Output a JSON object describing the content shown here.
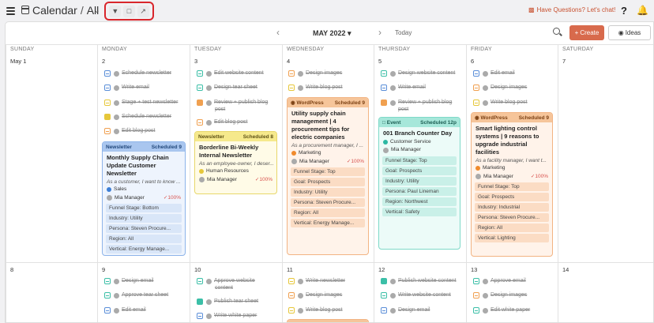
{
  "header": {
    "title": "Calendar",
    "view": "All",
    "help_text": "Have Questions? Let's chat!",
    "tools": [
      "filter-icon",
      "comment-icon",
      "share-icon"
    ]
  },
  "nav": {
    "month": "MAY 2022",
    "today": "Today",
    "create": "Create",
    "ideas": "Ideas"
  },
  "days": [
    "SUNDAY",
    "MONDAY",
    "TUESDAY",
    "WEDNESDAY",
    "THURSDAY",
    "FRIDAY",
    "SATURDAY"
  ],
  "week1": {
    "dates": [
      "May 1",
      "2",
      "3",
      "4",
      "5",
      "6",
      "7"
    ],
    "mon_tasks": [
      "Schedule newsletter",
      "Write email",
      "Stage + test newsletter",
      "Schedule newsletter",
      "Edit blog post"
    ],
    "tue_tasks": [
      "Edit website content",
      "Design tear sheet",
      "Review + publish blog",
      "post",
      "Edit blog post"
    ],
    "wed_tasks": [
      "Design images",
      "Write blog post"
    ],
    "thu_tasks": [
      "Design website content",
      "Write email",
      "Review + publish blog",
      "post"
    ],
    "fri_tasks": [
      "Edit email",
      "Design images",
      "Write blog post"
    ]
  },
  "cards": {
    "mon": {
      "type": "Newsletter",
      "status": "Scheduled 9",
      "title": "Monthly Supply Chain Update Customer Newsletter",
      "sub": "As a customer, I want to know ...",
      "tag": "Sales",
      "owner": "Mia Manager",
      "progress": "100%",
      "fields": [
        "Funnel Stage: Bottom",
        "Industry: Utility",
        "Persona: Steven Procure...",
        "Region: All",
        "Vertical: Energy Manage..."
      ]
    },
    "tue": {
      "type": "Newsletter",
      "status": "Scheduled 8",
      "title": "Borderline Bi-Weekly Internal Newsletter",
      "sub": "As an employee-owner, I deser...",
      "tag": "Human Resources",
      "owner": "Mia Manager",
      "progress": "100%"
    },
    "wed": {
      "type": "WordPress",
      "status": "Scheduled 9",
      "title": "Utility supply chain management | 4 procurement tips for electric companies",
      "sub": "As a procurement manager, I ...",
      "tag": "Marketing",
      "owner": "Mia Manager",
      "progress": "100%",
      "fields": [
        "Funnel Stage: Top",
        "Goal: Prospects",
        "Industry: Utility",
        "Persona: Steven Procure...",
        "Region: All",
        "Vertical: Energy Manage..."
      ]
    },
    "thu": {
      "type": "Event",
      "status": "Scheduled 12p",
      "title": "001 Branch Counter Day",
      "tag": "Customer Service",
      "owner": "Mia Manager",
      "fields": [
        "Funnel Stage: Top",
        "Goal: Prospects",
        "Industry: Utility",
        "Persona: Paul Lineman",
        "Region: Northwest",
        "Vertical: Safety"
      ]
    },
    "fri": {
      "type": "WordPress",
      "status": "Scheduled 9",
      "title": "Smart lighting control systems | 9 reasons to upgrade industrial facilities",
      "sub": "As a facility manager, I want t...",
      "tag": "Marketing",
      "owner": "Mia Manager",
      "progress": "100%",
      "fields": [
        "Funnel Stage: Top",
        "Goal: Prospects",
        "Industry: Industrial",
        "Persona: Steven Procure...",
        "Region: All",
        "Vertical: Lighting"
      ]
    }
  },
  "week2": {
    "dates": [
      "8",
      "9",
      "10",
      "11",
      "12",
      "13",
      "14"
    ],
    "mon_tasks": [
      "Design email",
      "Approve tear sheet",
      "Edit email"
    ],
    "tue_tasks": [
      "Approve website",
      "content",
      "Publish tear sheet",
      "Write white paper"
    ],
    "wed_tasks": [
      "Write newsletter",
      "Design images",
      "Write blog post"
    ],
    "thu_tasks": [
      "Publish website content",
      "Write website content",
      "Design email"
    ],
    "fri_tasks": [
      "Approve email",
      "Design images",
      "Edit white paper"
    ]
  },
  "colors": {
    "accent": "#d86a4c",
    "highlight": "#d9262c"
  }
}
